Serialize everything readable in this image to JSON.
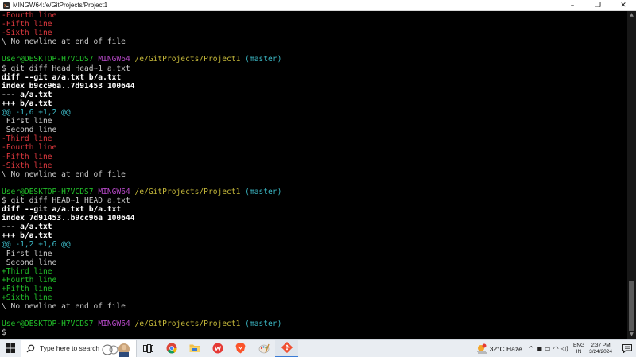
{
  "window": {
    "title": "MINGW64:/e/GitProjects/Project1",
    "minimize": "–",
    "maximize": "❐",
    "close": "✕"
  },
  "terminal": {
    "prompt": {
      "user": "User@DESKTOP-H7VCDS7",
      "env": "MINGW64",
      "path": "/e/GitProjects/Project1",
      "branch": "(master)",
      "dollar": "$"
    },
    "block0": {
      "removed": [
        "-Fourth line",
        "-Fifth line",
        "-Sixth line"
      ],
      "no_newline": "\\ No newline at end of file"
    },
    "block1": {
      "command": "$ git diff Head Head~1 a.txt",
      "diff_header": "diff --git a/a.txt b/a.txt",
      "index": "index b9cc96a..7d91453 100644",
      "minus_file": "--- a/a.txt",
      "plus_file": "+++ b/a.txt",
      "hunk": "@@ -1,6 +1,2 @@",
      "context": [
        " First line",
        " Second line"
      ],
      "removed": [
        "-Third line",
        "-Fourth line",
        "-Fifth line",
        "-Sixth line"
      ],
      "no_newline": "\\ No newline at end of file"
    },
    "block2": {
      "command": "$ git diff HEAD~1 HEAD a.txt",
      "diff_header": "diff --git a/a.txt b/a.txt",
      "index": "index 7d91453..b9cc96a 100644",
      "minus_file": "--- a/a.txt",
      "plus_file": "+++ b/a.txt",
      "hunk": "@@ -1,2 +1,6 @@",
      "context": [
        " First line",
        " Second line"
      ],
      "added": [
        "+Third line",
        "+Fourth line",
        "+Fifth line",
        "+Sixth line"
      ],
      "no_newline": "\\ No newline at end of file"
    },
    "final_prompt": "$"
  },
  "taskbar": {
    "search_placeholder": "Type here to search",
    "weather": "32°C  Haze",
    "lang_top": "ENG",
    "lang_bottom": "IN",
    "time": "2:37 PM",
    "date": "3/24/2024"
  },
  "colors": {
    "red": "#e0393f",
    "green": "#22c22a",
    "cyan": "#3cb9c6",
    "magenta": "#b84ac9",
    "yellow": "#c5b83a"
  }
}
